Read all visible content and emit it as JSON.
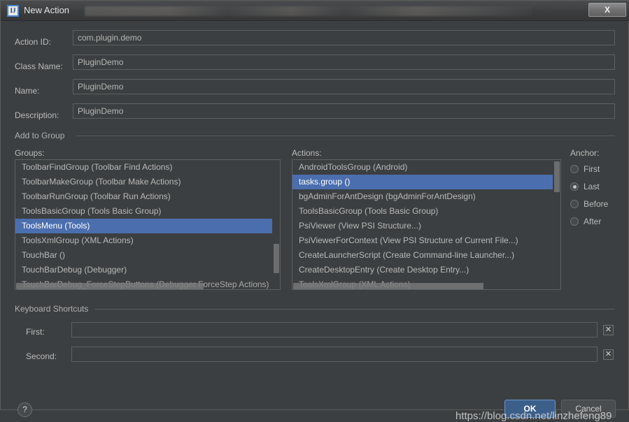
{
  "window": {
    "title": "New Action",
    "app_icon_text": "IJ",
    "close_label": "X"
  },
  "form": {
    "fields": [
      {
        "label": "Action ID:",
        "value": "com.plugin.demo",
        "placeholder": ""
      },
      {
        "label": "Class Name:",
        "value": "PluginDemo",
        "placeholder": ""
      },
      {
        "label": "Name:",
        "value": "PluginDemo",
        "placeholder": ""
      },
      {
        "label": "Description:",
        "value": "PluginDemo",
        "placeholder": ""
      }
    ]
  },
  "add_to_group": {
    "section_title": "Add to Group",
    "groups_label": "Groups:",
    "groups": [
      {
        "text": "ToolbarFindGroup (Toolbar Find Actions)",
        "selected": false
      },
      {
        "text": "ToolbarMakeGroup (Toolbar Make Actions)",
        "selected": false
      },
      {
        "text": "ToolbarRunGroup (Toolbar Run Actions)",
        "selected": false
      },
      {
        "text": "ToolsBasicGroup (Tools Basic Group)",
        "selected": false
      },
      {
        "text": "ToolsMenu (Tools)",
        "selected": true
      },
      {
        "text": "ToolsXmlGroup (XML Actions)",
        "selected": false
      },
      {
        "text": "TouchBar ()",
        "selected": false
      },
      {
        "text": "TouchBarDebug (Debugger)",
        "selected": false
      },
      {
        "text": "TouchBarDebug_ForceStepButtons (Debugger ForceStep Actions)",
        "selected": false
      }
    ],
    "actions_label": "Actions:",
    "actions": [
      {
        "text": "AndroidToolsGroup (Android)",
        "selected": false
      },
      {
        "text": "tasks.group ()",
        "selected": true
      },
      {
        "text": "bgAdminForAntDesign (bgAdminForAntDesign)",
        "selected": false
      },
      {
        "text": "ToolsBasicGroup (Tools Basic Group)",
        "selected": false
      },
      {
        "text": "PsiViewer (View PSI Structure...)",
        "selected": false
      },
      {
        "text": "PsiViewerForContext (View PSI Structure of Current File...)",
        "selected": false
      },
      {
        "text": "CreateLauncherScript (Create Command-line Launcher...)",
        "selected": false
      },
      {
        "text": "CreateDesktopEntry (Create Desktop Entry...)",
        "selected": false
      },
      {
        "text": "ToolsXmlGroup (XML Actions)",
        "selected": false
      }
    ],
    "anchor_label": "Anchor:",
    "anchor_options": [
      {
        "label": "First",
        "selected": false
      },
      {
        "label": "Last",
        "selected": true
      },
      {
        "label": "Before",
        "selected": false
      },
      {
        "label": "After",
        "selected": false
      }
    ]
  },
  "keyboard_shortcuts": {
    "section_title": "Keyboard Shortcuts",
    "first_label": "First:",
    "first_value": "",
    "first_placeholder": "",
    "second_label": "Second:",
    "second_value": "",
    "second_placeholder": "",
    "clear_label": "✕"
  },
  "footer": {
    "help_label": "?",
    "ok_label": "OK",
    "cancel_label": "Cancel",
    "watermark": "https://blog.csdn.net/linzhefeng89"
  },
  "colors": {
    "panel_bg": "#3c3f41",
    "selection_blue": "#4b6eaf",
    "ok_blue": "#3c5f8a",
    "text": "#bbbbbb",
    "border": "#5e6060"
  }
}
